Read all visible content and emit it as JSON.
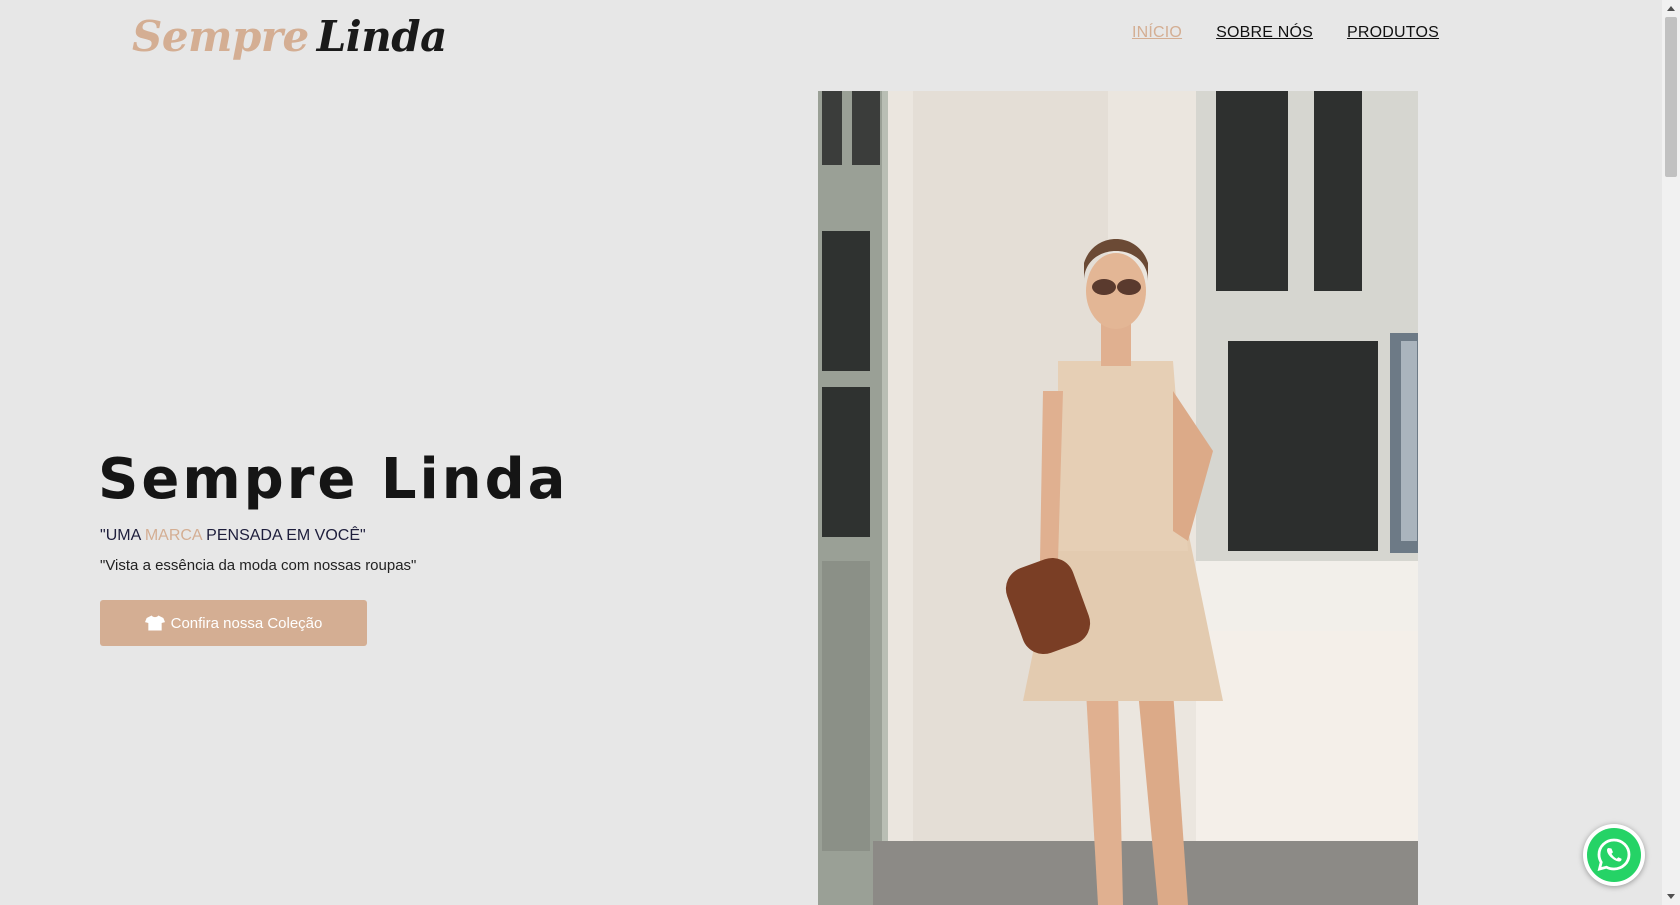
{
  "header": {
    "logo_part1": "Sempre",
    "logo_part2": "Linda",
    "nav": [
      {
        "label": "INÍCIO",
        "active": true
      },
      {
        "label": "SOBRE NÓS",
        "active": false
      },
      {
        "label": "PRODUTOS",
        "active": false
      }
    ]
  },
  "hero": {
    "title": "Sempre Linda",
    "tagline": {
      "open_quote": "\"",
      "w1": "UMA",
      "accent": "MARCA",
      "w2": "PENSADA EM VOCÊ",
      "close_quote": "\""
    },
    "subtext": "\"Vista a essência da moda com nossas roupas\"",
    "cta_label": "Confira nossa Coleção",
    "cta_icon": "tshirt-icon"
  },
  "colors": {
    "background": "#e7e7e7",
    "accent": "#d4ae93",
    "whatsapp": "#25d366"
  },
  "icons": {
    "floating": "whatsapp-icon"
  }
}
